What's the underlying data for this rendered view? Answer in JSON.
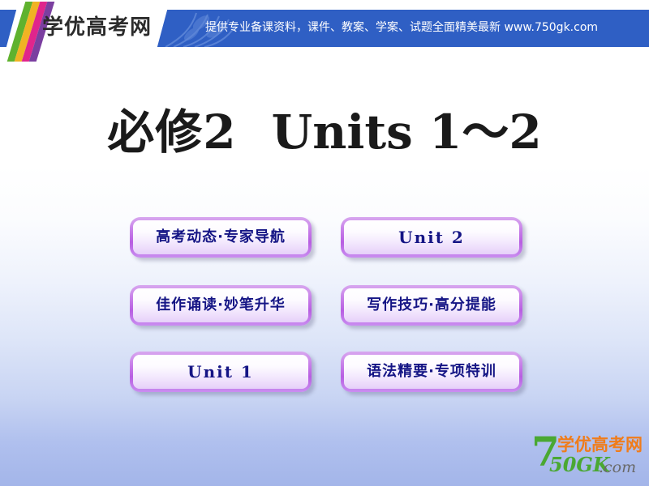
{
  "header": {
    "logo_text": "学优高考网",
    "tagline": "提供专业备课资料，课件、教案、学案、试题全面精美最新    www.750gk.com",
    "band_color": "#2f5fc4",
    "stripe_colors": [
      "#5fb22e",
      "#f0b323",
      "#e0258c",
      "#7b3fa0"
    ]
  },
  "title": {
    "cn": "必修",
    "number": "2",
    "en": "Units 1～2"
  },
  "menu": {
    "accent_color": "#b85ee2",
    "label_color": "#151585",
    "items": [
      {
        "label": "高考动态·专家导航",
        "lang": "cn",
        "row": 0,
        "col": 0
      },
      {
        "label": "Unit  2",
        "lang": "en",
        "row": 0,
        "col": 1
      },
      {
        "label": "佳作诵读·妙笔升华",
        "lang": "cn",
        "row": 1,
        "col": 0
      },
      {
        "label": "写作技巧·高分提能",
        "lang": "cn",
        "row": 1,
        "col": 1
      },
      {
        "label": "Unit  1",
        "lang": "en",
        "row": 2,
        "col": 0
      },
      {
        "label": "语法精要·专项特训",
        "lang": "cn",
        "row": 2,
        "col": 1
      }
    ]
  },
  "footer_logo": {
    "seven": "7",
    "cn": "学优高考网",
    "gk": "50GK",
    "dot_com": ".com",
    "green": "#4aa832",
    "orange": "#f07c1a"
  }
}
